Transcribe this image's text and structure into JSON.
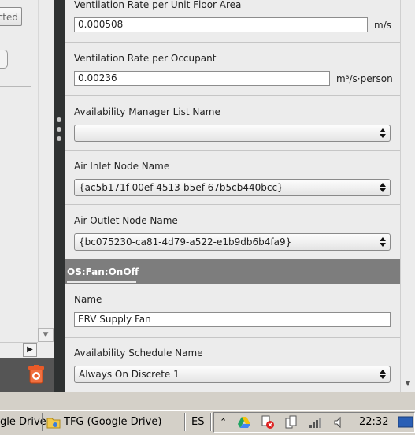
{
  "left_pane": {
    "button_partial_label": "cted"
  },
  "inspector": {
    "fields": [
      {
        "label": "Ventilation Rate per Unit Floor Area",
        "value": "0.000508",
        "unit": "m/s"
      },
      {
        "label": "Ventilation Rate per Occupant",
        "value": "0.00236",
        "unit": "m³/s·person"
      },
      {
        "label": "Availability Manager List Name",
        "value": ""
      },
      {
        "label": "Air Inlet Node Name",
        "value": "{ac5b171f-00ef-4513-b5ef-67b5cb440bcc}"
      },
      {
        "label": "Air Outlet Node Name",
        "value": "{bc075230-ca81-4d79-a522-e1b9db6b4fa9}"
      }
    ],
    "section_title": "OS:Fan:OnOff",
    "fan_fields": [
      {
        "label": "Name",
        "value": "ERV Supply Fan"
      },
      {
        "label": "Availability Schedule Name",
        "value": "Always On Discrete 1"
      }
    ]
  },
  "taskbar": {
    "items": [
      "gle Drive",
      "TFG (Google Drive)"
    ],
    "language": "ES",
    "clock": "22:32"
  },
  "icons": {
    "trash": "trash-icon",
    "folder": "folder-icon",
    "google-drive": "google-drive-icon"
  }
}
